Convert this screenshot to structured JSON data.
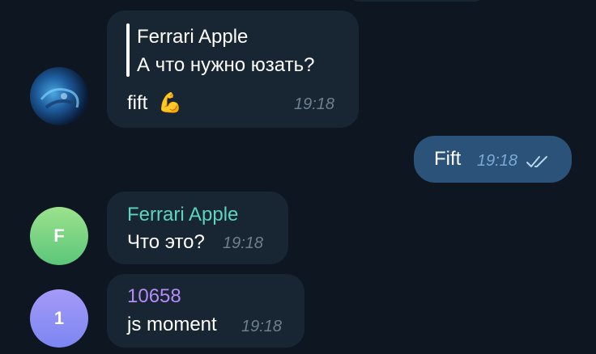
{
  "messages": [
    {
      "reply": {
        "author": "Ferrari Apple",
        "text": "А что нужно юзать?"
      },
      "text": "fift",
      "emoji": "💪",
      "time": "19:18"
    },
    {
      "text": "Fift",
      "time": "19:18",
      "status": "✓✓"
    },
    {
      "sender": "Ferrari Apple",
      "sender_color": "#5cd4be",
      "avatar_letter": "F",
      "avatar_color": "#7ed680",
      "text": "Что это?",
      "time": "19:18"
    },
    {
      "sender": "10658",
      "sender_color": "#b58cf7",
      "avatar_letter": "1",
      "avatar_color": "#8f8ef4",
      "text": "js moment",
      "time": "19:18"
    }
  ]
}
